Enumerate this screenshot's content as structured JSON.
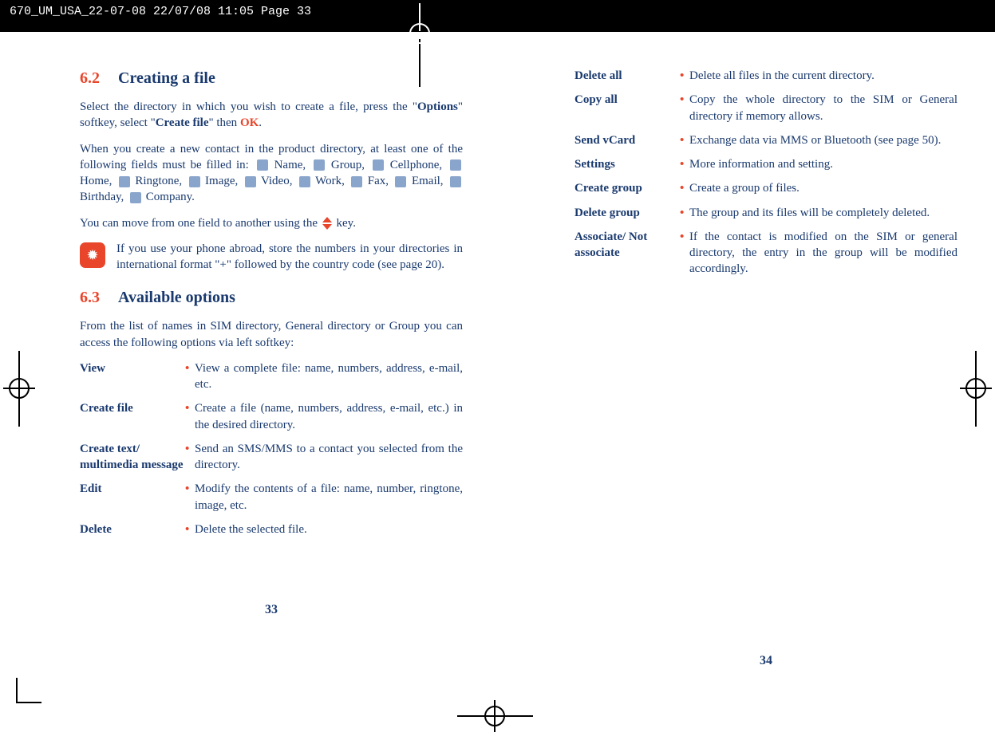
{
  "header": "670_UM_USA_22-07-08  22/07/08  11:05  Page 33",
  "left": {
    "sec62_num": "6.2",
    "sec62_title": "Creating a file",
    "p1_a": "Select the directory in which you wish to create a file, press the \"",
    "p1_b": "Options",
    "p1_c": "\" softkey, select \"",
    "p1_d": "Create file",
    "p1_e": "\" then ",
    "p1_ok": "OK",
    "p1_f": ".",
    "p2_a": "When you create a new contact in the product directory, at least one of the following fields must be filled in: ",
    "p2_fields": [
      {
        "icon": "person-icon",
        "label": "Name,"
      },
      {
        "icon": "group-icon",
        "label": "Group,"
      },
      {
        "icon": "cell-icon",
        "label": "Cellphone,"
      },
      {
        "icon": "home-icon",
        "label": "Home,"
      },
      {
        "icon": "ringtone-icon",
        "label": "Ringtone,"
      },
      {
        "icon": "image-icon",
        "label": "Image,"
      },
      {
        "icon": "video-icon",
        "label": "Video,"
      },
      {
        "icon": "work-icon",
        "label": "Work,"
      },
      {
        "icon": "fax-icon",
        "label": "Fax,"
      },
      {
        "icon": "email-icon",
        "label": "Email,"
      },
      {
        "icon": "birthday-icon",
        "label": "Birthday,"
      },
      {
        "icon": "company-icon",
        "label": "Company."
      }
    ],
    "p3_a": "You can move from one field to another using the ",
    "p3_b": " key.",
    "tip": "If you use your phone abroad, store the numbers in your directories in international format \"+\" followed by the country code (see page 20).",
    "sec63_num": "6.3",
    "sec63_title": "Available options",
    "p4": "From the list of names in SIM directory, General directory or Group you can access the following options via left softkey:",
    "options_left": [
      {
        "label": "View",
        "desc": "View a complete file: name, numbers, address, e-mail, etc."
      },
      {
        "label": "Create file",
        "desc": "Create a file (name, numbers, address, e-mail, etc.) in the desired directory."
      },
      {
        "label": "Create text/ multimedia message",
        "desc": "Send an SMS/MMS to a contact you selected from the directory."
      },
      {
        "label": "Edit",
        "desc": "Modify the contents of a file: name, number, ringtone, image, etc."
      },
      {
        "label": "Delete",
        "desc": "Delete the selected file."
      }
    ],
    "page_num": "33"
  },
  "right": {
    "options_right": [
      {
        "label": "Delete all",
        "desc": "Delete all files in the current directory."
      },
      {
        "label": "Copy all",
        "desc": "Copy the whole directory to the SIM or General directory if memory allows."
      },
      {
        "label": "Send vCard",
        "desc": "Exchange data via MMS or Bluetooth (see page 50)."
      },
      {
        "label": "Settings",
        "desc": "More information and setting."
      },
      {
        "label": "Create group",
        "desc": "Create a group of files."
      },
      {
        "label": "Delete group",
        "desc": "The group and its files will be completely deleted."
      },
      {
        "label": "Associate/ Not associate",
        "desc": "If the contact is modified on the SIM or general directory, the entry in the group will be modified accordingly."
      }
    ],
    "page_num": "34"
  }
}
